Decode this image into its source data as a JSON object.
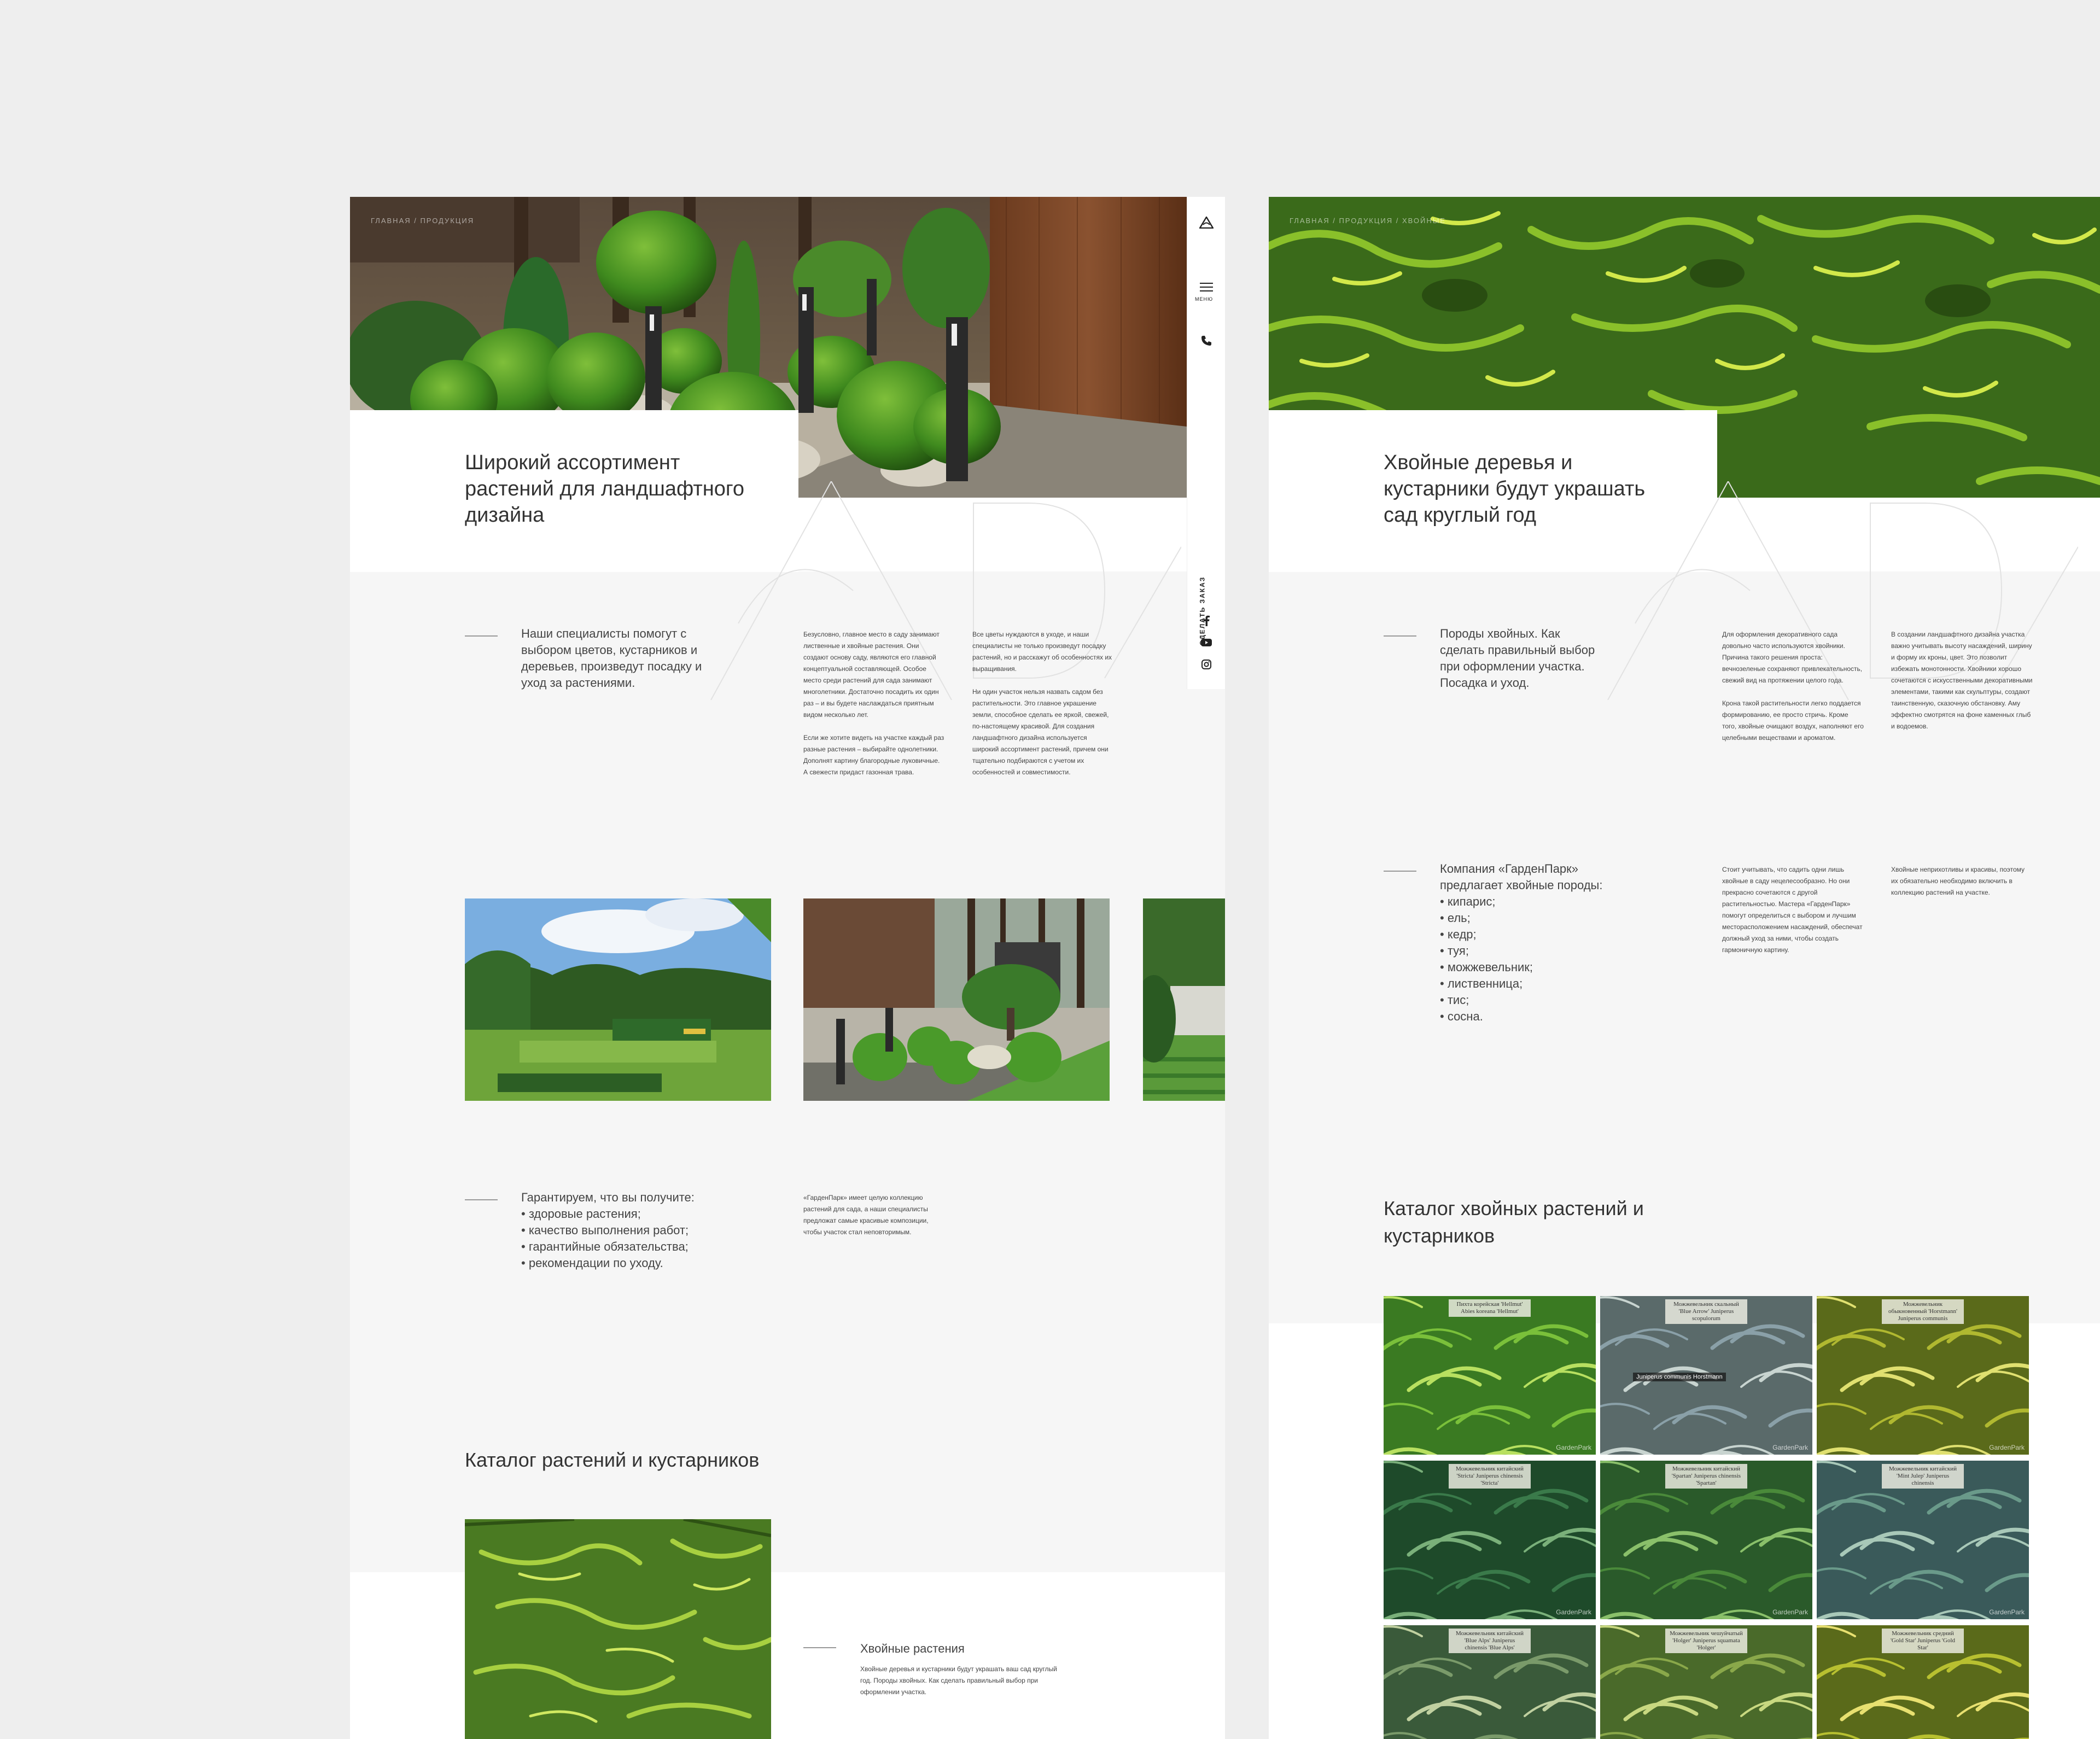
{
  "left": {
    "breadcrumb": "ГЛАВНАЯ / ПРОДУКЦИЯ",
    "hero_title": "Широкий ассортимент растений для ландшафтного дизайна",
    "rail": {
      "menu_label": "МЕНЮ",
      "order_label": "СДЕЛАТЬ ЗАКАЗ"
    },
    "intro": {
      "lead": "Наши специалисты помогут с выбором цветов, кустарников и деревьев, произведут посадку и уход за растениями.",
      "col1": [
        "Безусловно, главное место в саду занимают лиственные и хвойные растения. Они создают основу саду, являются его главной концептуальной составляющей. Особое место среди растений для сада занимают многолетники. Достаточно посадить их один раз – и вы будете наслаждаться приятным видом несколько лет.",
        "Если же хотите видеть на участке каждый раз разные растения – выбирайте однолетники. Дополнят картину благородные луковичные. А свежести придаст газонная трава."
      ],
      "col2": [
        "Все цветы нуждаются в уходе, и наши специалисты не только произведут посадку растений, но и расскажут об особенностях их выращивания.",
        "Ни один участок нельзя назвать садом без растительности. Это главное украшение земли, способное сделать ее яркой, свежей, по-настоящему красивой. Для создания ландшафтного дизайна используется широкий ассортимент растений, причем они тщательно подбираются с учетом их особенностей и совместимости."
      ]
    },
    "guarantee": {
      "lead": "Гарантируем, что вы получите:",
      "items": [
        "здоровые растения;",
        "качество выполнения работ;",
        "гарантийные обязательства;",
        "рекомендации по уходу."
      ],
      "note": "«ГарденПарк» имеет целую коллекцию растений для сада, а наши специалисты предложат самые красивые композиции, чтобы участок стал неповторимым."
    },
    "catalog": {
      "title": "Каталог растений и кустарников",
      "item_title": "Хвойные растения",
      "item_text": "Хвойные деревья и кустарники будут украшать ваш сад круглый год. Породы хвойных. Как сделать правильный выбор при оформлении участка."
    }
  },
  "right": {
    "breadcrumb": "ГЛАВНАЯ / ПРОДУКЦИЯ / ХВОЙНЫЕ",
    "hero_title": "Хвойные деревья и кустарники будут украшать сад круглый год",
    "intro": {
      "lead": "Породы хвойных. Как сделать правильный выбор при оформлении участка. Посадка и уход.",
      "col1": [
        "Для оформления декоративного сада довольно часто используются хвойники. Причина такого решения проста: вечнозеленые сохраняют привлекательность, свежий вид на протяжении целого года.",
        "Крона такой растительности легко поддается формированию, ее просто стричь. Кроме того, хвойные очищают воздух, наполняют его целебными веществами и ароматом."
      ],
      "col2": [
        "В создании ландшафтного дизайна участка важно учитывать высоту насаждений, ширину и форму их кроны, цвет. Это позволит избежать монотонности. Хвойники хорошо сочетаются с искусственными декоративными элементами, такими как скульптуры, создают таинственную, сказочную обстановку. Аму эффектно смотрятся на фоне каменных глыб и водоемов."
      ]
    },
    "company": {
      "lead": "Компания «ГарденПарк» предлагает хвойные породы:",
      "items": [
        "кипарис;",
        "ель;",
        "кедр;",
        "туя;",
        "можжевельник;",
        "лиственница;",
        "тис;",
        "сосна."
      ],
      "col1": "Стоит учитывать, что садить одни лишь хвойные в саду нецелесообразно. Но они прекрасно сочетаются с другой растительностью. Мастера «ГарденПарк» помогут определиться с выбором и лучшим месторасположением насаждений, обеспечат должный уход за ними, чтобы создать гармоничную картину.",
      "col2": "Хвойные неприхотливы и красивы, поэтому их обязательно необходимо включить в коллекцию растений на участке."
    },
    "catalog": {
      "title": "Каталог хвойных растений и кустарников",
      "tags": [
        "Пихта корейская 'Hellmut' Abies koreana 'Hellmut'",
        "Можжевельник скальный 'Blue Arrow' Juniperus scopulorum",
        "Можжевельник обыкновенный 'Horstmann' Juniperus communis",
        "Можжевельник китайский 'Stricta' Juniperus chinensis 'Stricta'",
        "Можжевельник китайский 'Spartan' Juniperus chinensis 'Spartan'",
        "Можжевельник китайский 'Mint Julep' Juniperus chinensis",
        "Можжевельник китайский 'Blue Alps' Juniperus chinensis 'Blue Alps'",
        "Можжевельник чешуйчатый 'Holger' Juniperus squamata 'Holger'",
        "Можжевельник средний 'Gold Star' Juniperus 'Gold Star'"
      ],
      "caption_over_image": "Juniperus communis Horstmann",
      "watermark": "GardenPark"
    }
  },
  "colors": {
    "page_bg": "#eeeeee",
    "band": "#f6f6f6",
    "text": "#333333",
    "accent_green": "#5a8f2a"
  }
}
